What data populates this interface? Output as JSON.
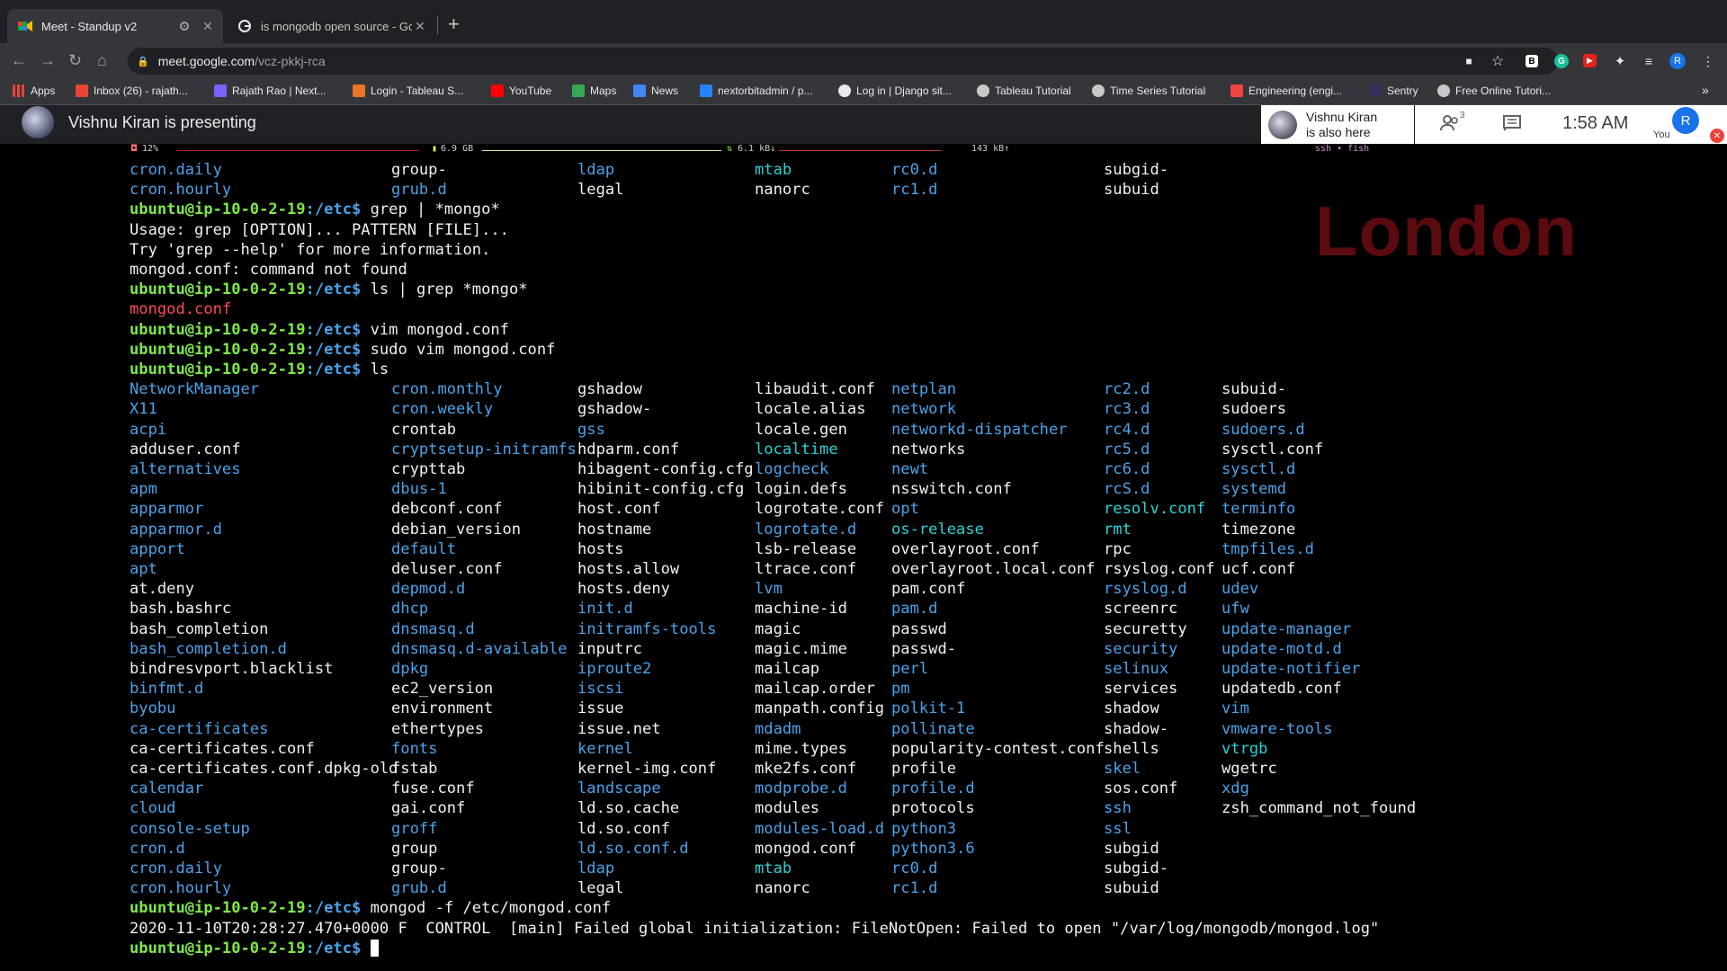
{
  "browser": {
    "tabs": [
      {
        "title": "Meet - Standup v2",
        "active": true
      },
      {
        "title": "is mongodb open source - Goo",
        "active": false
      }
    ],
    "url": {
      "host": "meet.google.com",
      "path": "/vcz-pkkj-rca"
    },
    "bookmarks": [
      {
        "label": "Apps",
        "color": "#e8eaed"
      },
      {
        "label": "Inbox (26) - rajath...",
        "color": "#ea4335"
      },
      {
        "label": "Rajath Rao | Next...",
        "color": "#7b61ff"
      },
      {
        "label": "Login - Tableau S...",
        "color": "#e97627"
      },
      {
        "label": "YouTube",
        "color": "#ff0000"
      },
      {
        "label": "Maps",
        "color": "#34a853"
      },
      {
        "label": "News",
        "color": "#4285f4"
      },
      {
        "label": "nextorbitadmin / p...",
        "color": "#2684ff"
      },
      {
        "label": "Log in | Django sit...",
        "color": "#e8eaed"
      },
      {
        "label": "Tableau Tutorial",
        "color": "#c8c8c8"
      },
      {
        "label": "Time Series Tutorial",
        "color": "#c8c8c8"
      },
      {
        "label": "Engineering (engi...",
        "color": "#e44"
      },
      {
        "label": "Sentry",
        "color": "#362d59"
      },
      {
        "label": "Free Online Tutori...",
        "color": "#c8c8c8"
      }
    ],
    "more_bookmarks": "»"
  },
  "meet": {
    "presenting_text": "Vishnu Kiran is presenting",
    "also_here_name": "Vishnu Kiran",
    "also_here_sub": "is also here",
    "people_count": "3",
    "time": "1:58 AM",
    "you_initial": "R",
    "you_label": "You"
  },
  "terminal": {
    "status": {
      "cpu": "12%",
      "mem": "6.9 GB",
      "net_down": "6.1 kB↓",
      "net_up": "143 kB↑",
      "session": "ssh • fish"
    },
    "watermark": "London",
    "prompt_user": "ubuntu@ip-10-0-2-19",
    "prompt_path": ":/etc$",
    "lines": [
      {
        "type": "cols",
        "cells": [
          [
            "cron.daily",
            "b"
          ],
          [
            "group-",
            "w"
          ],
          [
            "ldap",
            "b"
          ],
          [
            "mtab",
            "cy"
          ],
          [
            "rc0.d",
            "b"
          ],
          [
            "subgid-",
            "w"
          ]
        ]
      },
      {
        "type": "cols",
        "cells": [
          [
            "cron.hourly",
            "b"
          ],
          [
            "grub.d",
            "b"
          ],
          [
            "legal",
            "w"
          ],
          [
            "nanorc",
            "w"
          ],
          [
            "rc1.d",
            "b"
          ],
          [
            "subuid",
            "w"
          ]
        ]
      },
      {
        "type": "cmd",
        "text": " grep | *mongo*"
      },
      {
        "type": "out",
        "text": "Usage: grep [OPTION]... PATTERN [FILE]...",
        "color": "w"
      },
      {
        "type": "out",
        "text": "Try 'grep --help' for more information.",
        "color": "w"
      },
      {
        "type": "out",
        "text": "mongod.conf: command not found",
        "color": "w"
      },
      {
        "type": "cmd",
        "text": " ls | grep *mongo*"
      },
      {
        "type": "out",
        "text": "mongod.conf",
        "color": "r"
      },
      {
        "type": "cmd",
        "text": " vim mongod.conf"
      },
      {
        "type": "cmd",
        "text": " sudo vim mongod.conf"
      },
      {
        "type": "cmd",
        "text": " ls"
      },
      {
        "type": "cols",
        "cells": [
          [
            "NetworkManager",
            "b"
          ],
          [
            "cron.monthly",
            "b"
          ],
          [
            "gshadow",
            "w"
          ],
          [
            "libaudit.conf",
            "w"
          ],
          [
            "netplan",
            "b"
          ],
          [
            "rc2.d",
            "b"
          ],
          [
            "subuid-",
            "w"
          ]
        ]
      },
      {
        "type": "cols",
        "cells": [
          [
            "X11",
            "b"
          ],
          [
            "cron.weekly",
            "b"
          ],
          [
            "gshadow-",
            "w"
          ],
          [
            "locale.alias",
            "w"
          ],
          [
            "network",
            "b"
          ],
          [
            "rc3.d",
            "b"
          ],
          [
            "sudoers",
            "w"
          ]
        ]
      },
      {
        "type": "cols",
        "cells": [
          [
            "acpi",
            "b"
          ],
          [
            "crontab",
            "w"
          ],
          [
            "gss",
            "b"
          ],
          [
            "locale.gen",
            "w"
          ],
          [
            "networkd-dispatcher",
            "b"
          ],
          [
            "rc4.d",
            "b"
          ],
          [
            "sudoers.d",
            "b"
          ]
        ]
      },
      {
        "type": "cols",
        "cells": [
          [
            "adduser.conf",
            "w"
          ],
          [
            "cryptsetup-initramfs",
            "b"
          ],
          [
            "hdparm.conf",
            "w"
          ],
          [
            "localtime",
            "cy"
          ],
          [
            "networks",
            "w"
          ],
          [
            "rc5.d",
            "b"
          ],
          [
            "sysctl.conf",
            "w"
          ]
        ]
      },
      {
        "type": "cols",
        "cells": [
          [
            "alternatives",
            "b"
          ],
          [
            "crypttab",
            "w"
          ],
          [
            "hibagent-config.cfg",
            "w"
          ],
          [
            "logcheck",
            "b"
          ],
          [
            "newt",
            "b"
          ],
          [
            "rc6.d",
            "b"
          ],
          [
            "sysctl.d",
            "b"
          ]
        ]
      },
      {
        "type": "cols",
        "cells": [
          [
            "apm",
            "b"
          ],
          [
            "dbus-1",
            "b"
          ],
          [
            "hibinit-config.cfg",
            "w"
          ],
          [
            "login.defs",
            "w"
          ],
          [
            "nsswitch.conf",
            "w"
          ],
          [
            "rcS.d",
            "b"
          ],
          [
            "systemd",
            "b"
          ]
        ]
      },
      {
        "type": "cols",
        "cells": [
          [
            "apparmor",
            "b"
          ],
          [
            "debconf.conf",
            "w"
          ],
          [
            "host.conf",
            "w"
          ],
          [
            "logrotate.conf",
            "w"
          ],
          [
            "opt",
            "b"
          ],
          [
            "resolv.conf",
            "cy"
          ],
          [
            "terminfo",
            "b"
          ]
        ]
      },
      {
        "type": "cols",
        "cells": [
          [
            "apparmor.d",
            "b"
          ],
          [
            "debian_version",
            "w"
          ],
          [
            "hostname",
            "w"
          ],
          [
            "logrotate.d",
            "b"
          ],
          [
            "os-release",
            "cy"
          ],
          [
            "rmt",
            "cy"
          ],
          [
            "timezone",
            "w"
          ]
        ]
      },
      {
        "type": "cols",
        "cells": [
          [
            "apport",
            "b"
          ],
          [
            "default",
            "b"
          ],
          [
            "hosts",
            "w"
          ],
          [
            "lsb-release",
            "w"
          ],
          [
            "overlayroot.conf",
            "w"
          ],
          [
            "rpc",
            "w"
          ],
          [
            "tmpfiles.d",
            "b"
          ]
        ]
      },
      {
        "type": "cols",
        "cells": [
          [
            "apt",
            "b"
          ],
          [
            "deluser.conf",
            "w"
          ],
          [
            "hosts.allow",
            "w"
          ],
          [
            "ltrace.conf",
            "w"
          ],
          [
            "overlayroot.local.conf",
            "w"
          ],
          [
            "rsyslog.conf",
            "w"
          ],
          [
            "ucf.conf",
            "w"
          ]
        ]
      },
      {
        "type": "cols",
        "cells": [
          [
            "at.deny",
            "w"
          ],
          [
            "depmod.d",
            "b"
          ],
          [
            "hosts.deny",
            "w"
          ],
          [
            "lvm",
            "b"
          ],
          [
            "pam.conf",
            "w"
          ],
          [
            "rsyslog.d",
            "b"
          ],
          [
            "udev",
            "b"
          ]
        ]
      },
      {
        "type": "cols",
        "cells": [
          [
            "bash.bashrc",
            "w"
          ],
          [
            "dhcp",
            "b"
          ],
          [
            "init.d",
            "b"
          ],
          [
            "machine-id",
            "w"
          ],
          [
            "pam.d",
            "b"
          ],
          [
            "screenrc",
            "w"
          ],
          [
            "ufw",
            "b"
          ]
        ]
      },
      {
        "type": "cols",
        "cells": [
          [
            "bash_completion",
            "w"
          ],
          [
            "dnsmasq.d",
            "b"
          ],
          [
            "initramfs-tools",
            "b"
          ],
          [
            "magic",
            "w"
          ],
          [
            "passwd",
            "w"
          ],
          [
            "securetty",
            "w"
          ],
          [
            "update-manager",
            "b"
          ]
        ]
      },
      {
        "type": "cols",
        "cells": [
          [
            "bash_completion.d",
            "b"
          ],
          [
            "dnsmasq.d-available",
            "b"
          ],
          [
            "inputrc",
            "w"
          ],
          [
            "magic.mime",
            "w"
          ],
          [
            "passwd-",
            "w"
          ],
          [
            "security",
            "b"
          ],
          [
            "update-motd.d",
            "b"
          ]
        ]
      },
      {
        "type": "cols",
        "cells": [
          [
            "bindresvport.blacklist",
            "w"
          ],
          [
            "dpkg",
            "b"
          ],
          [
            "iproute2",
            "b"
          ],
          [
            "mailcap",
            "w"
          ],
          [
            "perl",
            "b"
          ],
          [
            "selinux",
            "b"
          ],
          [
            "update-notifier",
            "b"
          ]
        ]
      },
      {
        "type": "cols",
        "cells": [
          [
            "binfmt.d",
            "b"
          ],
          [
            "ec2_version",
            "w"
          ],
          [
            "iscsi",
            "b"
          ],
          [
            "mailcap.order",
            "w"
          ],
          [
            "pm",
            "b"
          ],
          [
            "services",
            "w"
          ],
          [
            "updatedb.conf",
            "w"
          ]
        ]
      },
      {
        "type": "cols",
        "cells": [
          [
            "byobu",
            "b"
          ],
          [
            "environment",
            "w"
          ],
          [
            "issue",
            "w"
          ],
          [
            "manpath.config",
            "w"
          ],
          [
            "polkit-1",
            "b"
          ],
          [
            "shadow",
            "w"
          ],
          [
            "vim",
            "b"
          ]
        ]
      },
      {
        "type": "cols",
        "cells": [
          [
            "ca-certificates",
            "b"
          ],
          [
            "ethertypes",
            "w"
          ],
          [
            "issue.net",
            "w"
          ],
          [
            "mdadm",
            "b"
          ],
          [
            "pollinate",
            "b"
          ],
          [
            "shadow-",
            "w"
          ],
          [
            "vmware-tools",
            "b"
          ]
        ]
      },
      {
        "type": "cols",
        "cells": [
          [
            "ca-certificates.conf",
            "w"
          ],
          [
            "fonts",
            "b"
          ],
          [
            "kernel",
            "b"
          ],
          [
            "mime.types",
            "w"
          ],
          [
            "popularity-contest.conf",
            "w"
          ],
          [
            "shells",
            "w"
          ],
          [
            "vtrgb",
            "cy"
          ]
        ]
      },
      {
        "type": "cols",
        "cells": [
          [
            "ca-certificates.conf.dpkg-old",
            "w"
          ],
          [
            "fstab",
            "w"
          ],
          [
            "kernel-img.conf",
            "w"
          ],
          [
            "mke2fs.conf",
            "w"
          ],
          [
            "profile",
            "w"
          ],
          [
            "skel",
            "b"
          ],
          [
            "wgetrc",
            "w"
          ]
        ]
      },
      {
        "type": "cols",
        "cells": [
          [
            "calendar",
            "b"
          ],
          [
            "fuse.conf",
            "w"
          ],
          [
            "landscape",
            "b"
          ],
          [
            "modprobe.d",
            "b"
          ],
          [
            "profile.d",
            "b"
          ],
          [
            "sos.conf",
            "w"
          ],
          [
            "xdg",
            "b"
          ]
        ]
      },
      {
        "type": "cols",
        "cells": [
          [
            "cloud",
            "b"
          ],
          [
            "gai.conf",
            "w"
          ],
          [
            "ld.so.cache",
            "w"
          ],
          [
            "modules",
            "w"
          ],
          [
            "protocols",
            "w"
          ],
          [
            "ssh",
            "b"
          ],
          [
            "zsh_command_not_found",
            "w"
          ]
        ]
      },
      {
        "type": "cols",
        "cells": [
          [
            "console-setup",
            "b"
          ],
          [
            "groff",
            "b"
          ],
          [
            "ld.so.conf",
            "w"
          ],
          [
            "modules-load.d",
            "b"
          ],
          [
            "python3",
            "b"
          ],
          [
            "ssl",
            "b"
          ]
        ]
      },
      {
        "type": "cols",
        "cells": [
          [
            "cron.d",
            "b"
          ],
          [
            "group",
            "w"
          ],
          [
            "ld.so.conf.d",
            "b"
          ],
          [
            "mongod.conf",
            "w"
          ],
          [
            "python3.6",
            "b"
          ],
          [
            "subgid",
            "w"
          ]
        ]
      },
      {
        "type": "cols",
        "cells": [
          [
            "cron.daily",
            "b"
          ],
          [
            "group-",
            "w"
          ],
          [
            "ldap",
            "b"
          ],
          [
            "mtab",
            "cy"
          ],
          [
            "rc0.d",
            "b"
          ],
          [
            "subgid-",
            "w"
          ]
        ]
      },
      {
        "type": "cols",
        "cells": [
          [
            "cron.hourly",
            "b"
          ],
          [
            "grub.d",
            "b"
          ],
          [
            "legal",
            "w"
          ],
          [
            "nanorc",
            "w"
          ],
          [
            "rc1.d",
            "b"
          ],
          [
            "subuid",
            "w"
          ]
        ]
      },
      {
        "type": "cmd",
        "text": " mongod -f /etc/mongod.conf"
      },
      {
        "type": "out",
        "text": "2020-11-10T20:28:27.470+0000 F  CONTROL  [main] Failed global initialization: FileNotOpen: Failed to open \"/var/log/mongodb/mongod.log\"",
        "color": "w"
      },
      {
        "type": "cmd",
        "text": " ",
        "cursor": true
      }
    ]
  }
}
